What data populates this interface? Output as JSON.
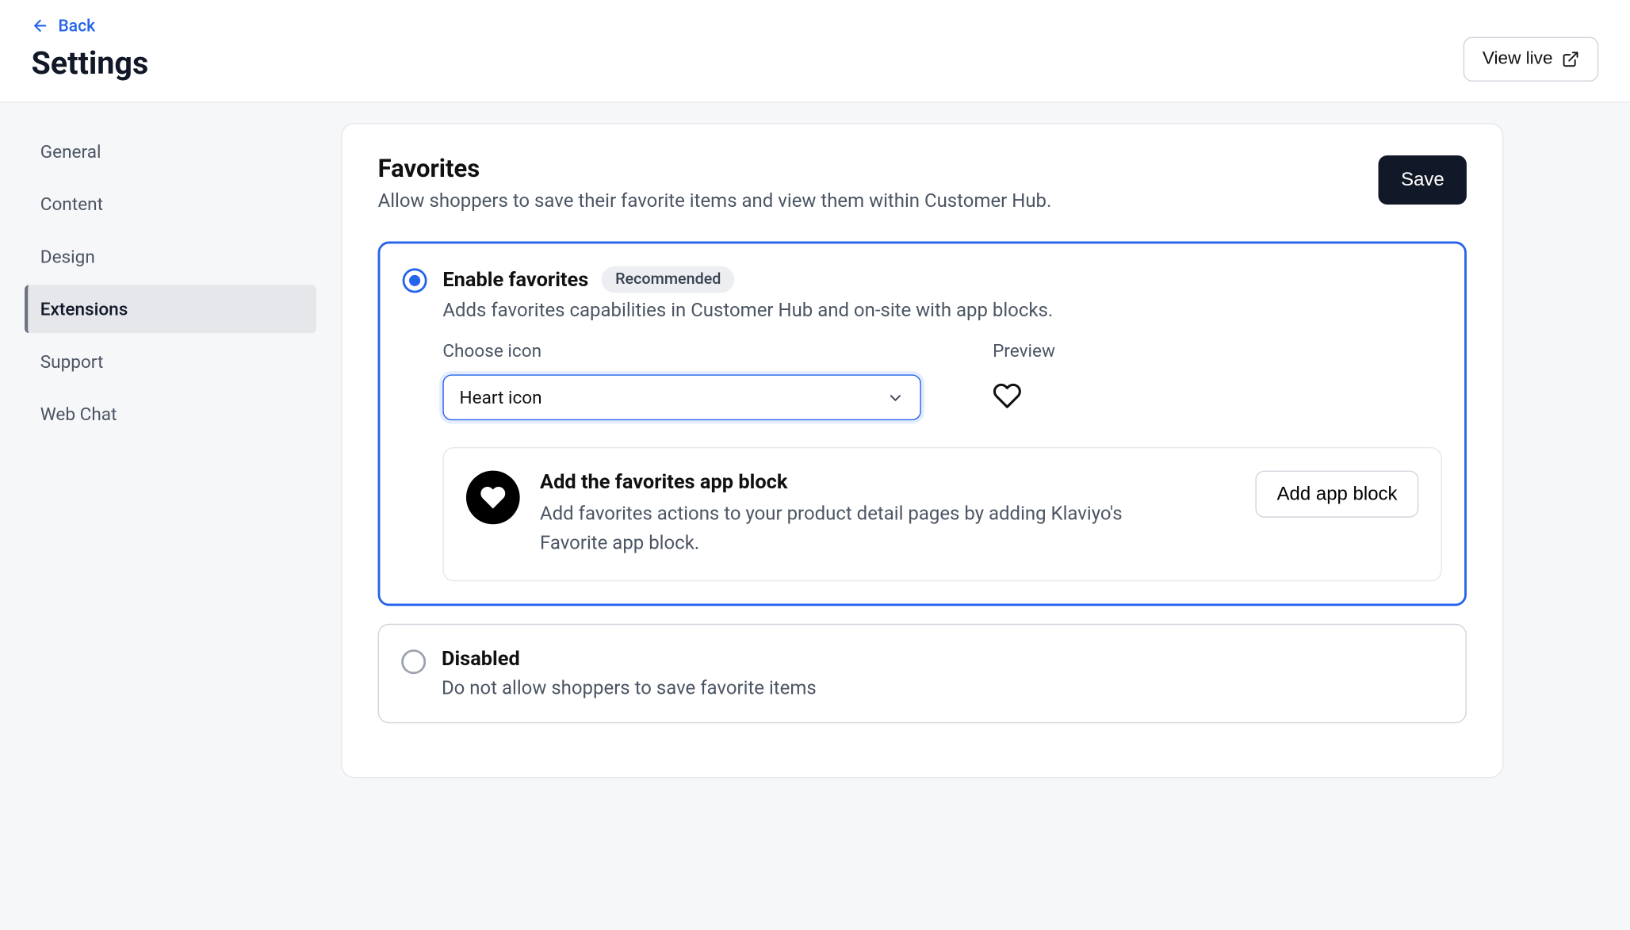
{
  "header": {
    "back_label": "Back",
    "title": "Settings",
    "view_live_label": "View live"
  },
  "sidebar": {
    "items": [
      {
        "label": "General"
      },
      {
        "label": "Content"
      },
      {
        "label": "Design"
      },
      {
        "label": "Extensions"
      },
      {
        "label": "Support"
      },
      {
        "label": "Web Chat"
      }
    ],
    "active_index": 3
  },
  "card": {
    "title": "Favorites",
    "description": "Allow shoppers to save their favorite items and view them within Customer Hub.",
    "save_label": "Save"
  },
  "option_enable": {
    "title": "Enable favorites",
    "badge": "Recommended",
    "sub": "Adds favorites capabilities in Customer Hub and on-site with app blocks.",
    "choose_label": "Choose icon",
    "preview_label": "Preview",
    "select_value": "Heart icon"
  },
  "sub_card": {
    "title": "Add the favorites app block",
    "desc": "Add favorites actions to your product detail pages by adding Klaviyo's Favorite app block.",
    "button": "Add app block"
  },
  "option_disabled": {
    "title": "Disabled",
    "sub": "Do not allow shoppers to save favorite items"
  }
}
